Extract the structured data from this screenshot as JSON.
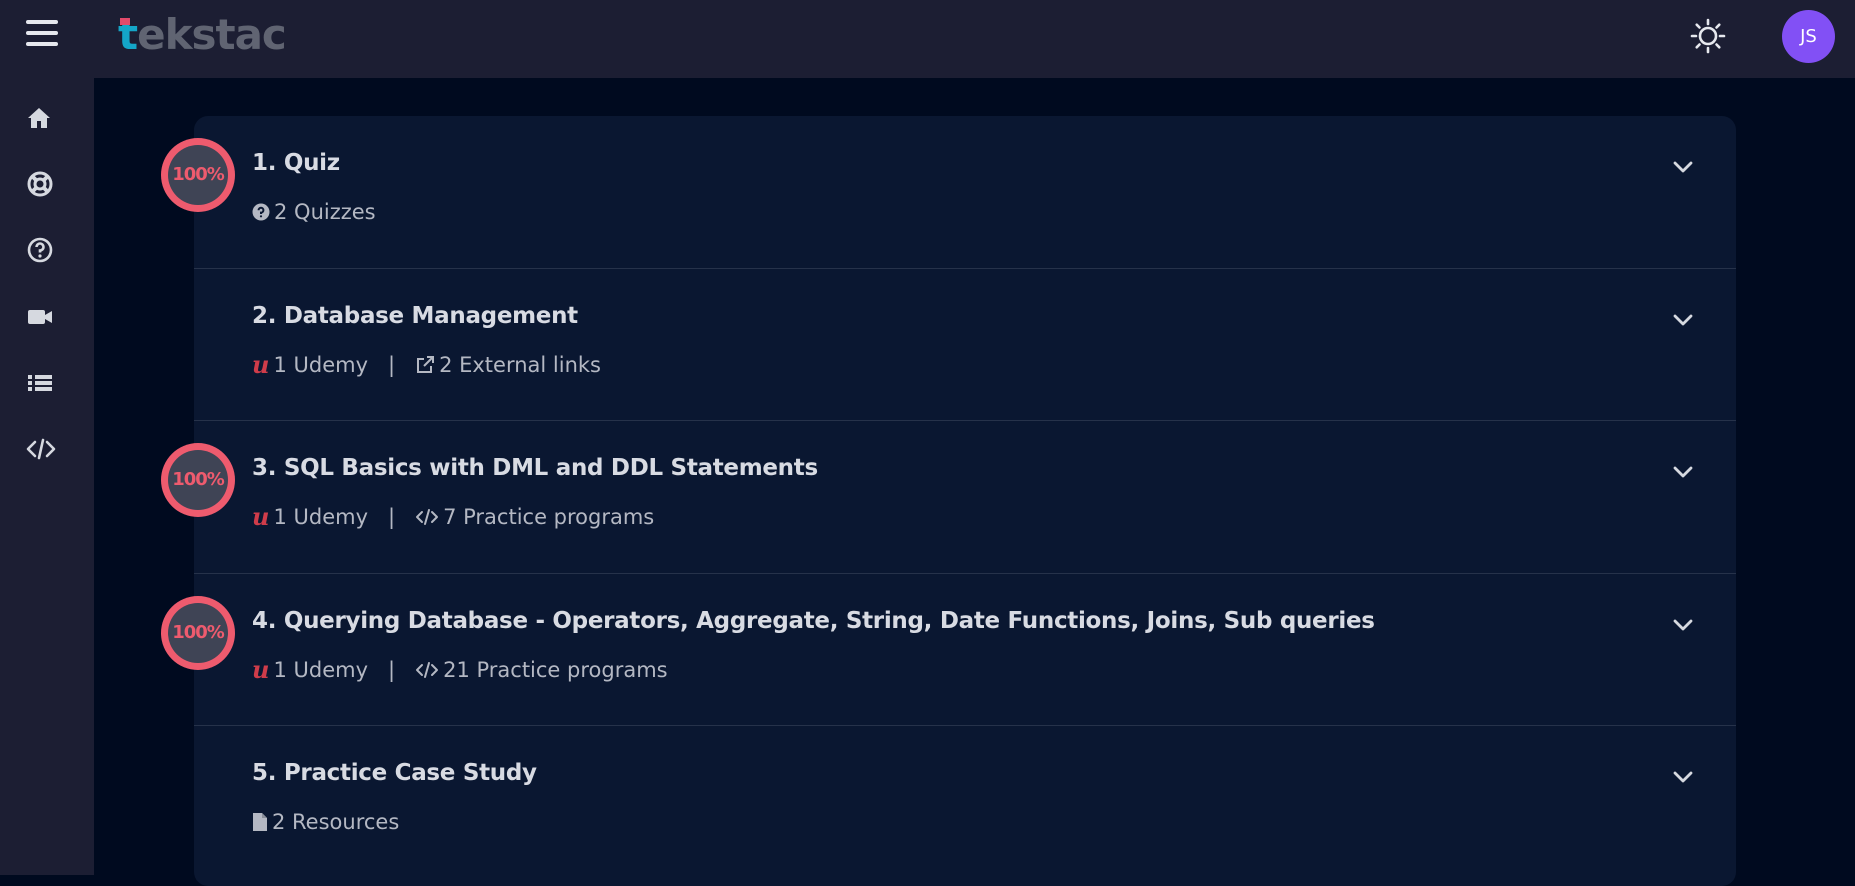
{
  "header": {
    "logo_text_first": "t",
    "logo_text_rest": "ekstac",
    "menu_icon": "hamburger-menu-icon",
    "theme_icon": "sun-icon",
    "avatar_initials": "JS",
    "avatar_color": "#8250f5"
  },
  "sidebar": {
    "items": [
      {
        "icon": "home-icon"
      },
      {
        "icon": "lifebuoy-icon"
      },
      {
        "icon": "help-circle-icon"
      },
      {
        "icon": "video-camera-icon"
      },
      {
        "icon": "list-icon"
      },
      {
        "icon": "code-icon"
      }
    ]
  },
  "colors": {
    "accent_pink": "#ee5b6e",
    "udemy_red": "#cf3c4a",
    "background": "#000a1f",
    "card": "#0a1731"
  },
  "modules": [
    {
      "title": "1. Quiz",
      "progress": "100%",
      "meta": [
        {
          "icon": "question-circle-icon",
          "text": "2 Quizzes"
        }
      ]
    },
    {
      "title": "2. Database Management",
      "progress": "",
      "meta": [
        {
          "icon": "udemy-icon",
          "text": "1 Udemy"
        },
        {
          "icon": "external-link-icon",
          "text": "2 External links"
        }
      ]
    },
    {
      "title": "3. SQL Basics with DML and DDL Statements",
      "progress": "100%",
      "meta": [
        {
          "icon": "udemy-icon",
          "text": "1 Udemy"
        },
        {
          "icon": "code-icon",
          "text": "7 Practice programs"
        }
      ]
    },
    {
      "title": "4. Querying Database - Operators, Aggregate, String, Date Functions, Joins, Sub queries",
      "progress": "100%",
      "meta": [
        {
          "icon": "udemy-icon",
          "text": "1 Udemy"
        },
        {
          "icon": "code-icon",
          "text": "21 Practice programs"
        }
      ]
    },
    {
      "title": "5. Practice Case Study",
      "progress": "",
      "meta": [
        {
          "icon": "file-icon",
          "text": "2 Resources"
        }
      ]
    }
  ],
  "separator": "|",
  "udemy_glyph": "u"
}
